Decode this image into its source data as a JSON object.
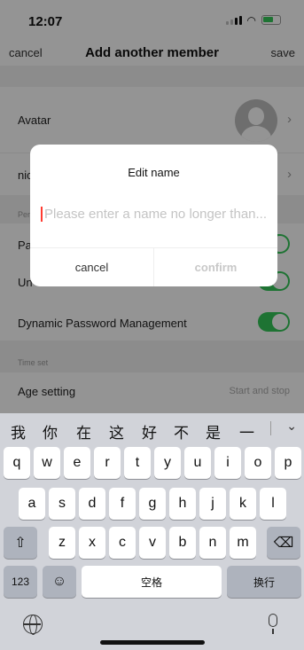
{
  "status_bar": {
    "time": "12:07"
  },
  "nav": {
    "cancel": "cancel",
    "title": "Add another member",
    "save": "save"
  },
  "rows": {
    "avatar": "Avatar",
    "nickname": "nic",
    "permission_header": "Per",
    "permission_1": "Pa",
    "permission_2": "Un",
    "dynamic_password": "Dynamic Password Management",
    "time_header": "Time set",
    "age_setting": "Age setting",
    "age_value": "Start and stop"
  },
  "dialog": {
    "title": "Edit name",
    "placeholder": "Please enter a name no longer than...",
    "cancel": "cancel",
    "confirm": "confirm"
  },
  "keyboard": {
    "candidates": [
      "我",
      "你",
      "在",
      "这",
      "好",
      "不",
      "是",
      "一"
    ],
    "row1": [
      "q",
      "w",
      "e",
      "r",
      "t",
      "y",
      "u",
      "i",
      "o",
      "p"
    ],
    "row2": [
      "a",
      "s",
      "d",
      "f",
      "g",
      "h",
      "j",
      "k",
      "l"
    ],
    "row3": [
      "z",
      "x",
      "c",
      "v",
      "b",
      "n",
      "m"
    ],
    "numbers_key": "123",
    "space_key": "空格",
    "return_key": "换行"
  },
  "colors": {
    "toggle_on": "#34c759",
    "cursor": "#ff3b30"
  }
}
